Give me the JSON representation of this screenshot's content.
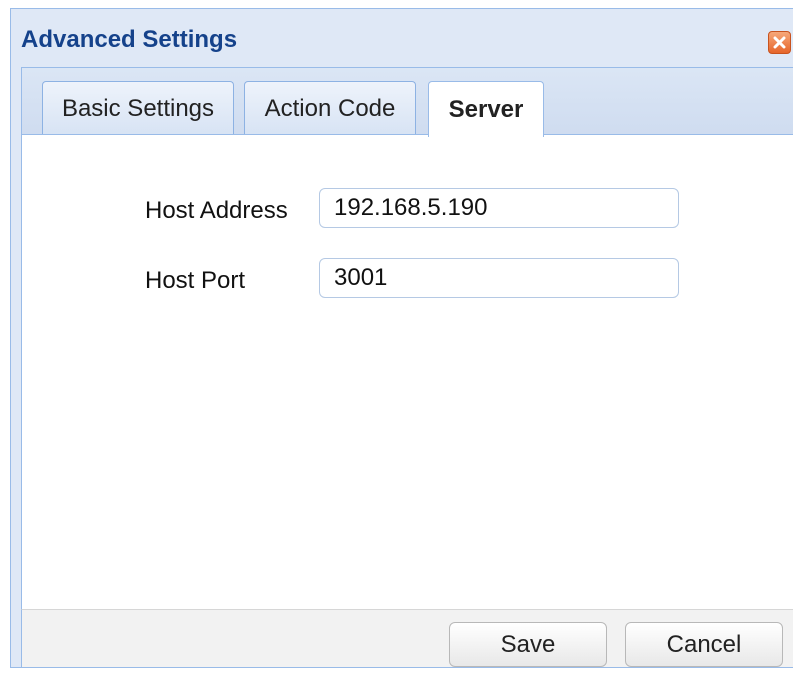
{
  "dialog": {
    "title": "Advanced Settings",
    "close_icon": "close-icon"
  },
  "tabs": [
    {
      "label": "Basic Settings",
      "active": false
    },
    {
      "label": "Action Code",
      "active": false
    },
    {
      "label": "Server",
      "active": true
    }
  ],
  "server": {
    "host_address_label": "Host Address",
    "host_address_value": "192.168.5.190",
    "host_port_label": "Host Port",
    "host_port_value": "3001"
  },
  "footer": {
    "save_label": "Save",
    "cancel_label": "Cancel"
  },
  "colors": {
    "title_text": "#15428b",
    "dialog_bg": "#dfe8f6",
    "border": "#99bbe8",
    "close_button": "#e6652a"
  }
}
